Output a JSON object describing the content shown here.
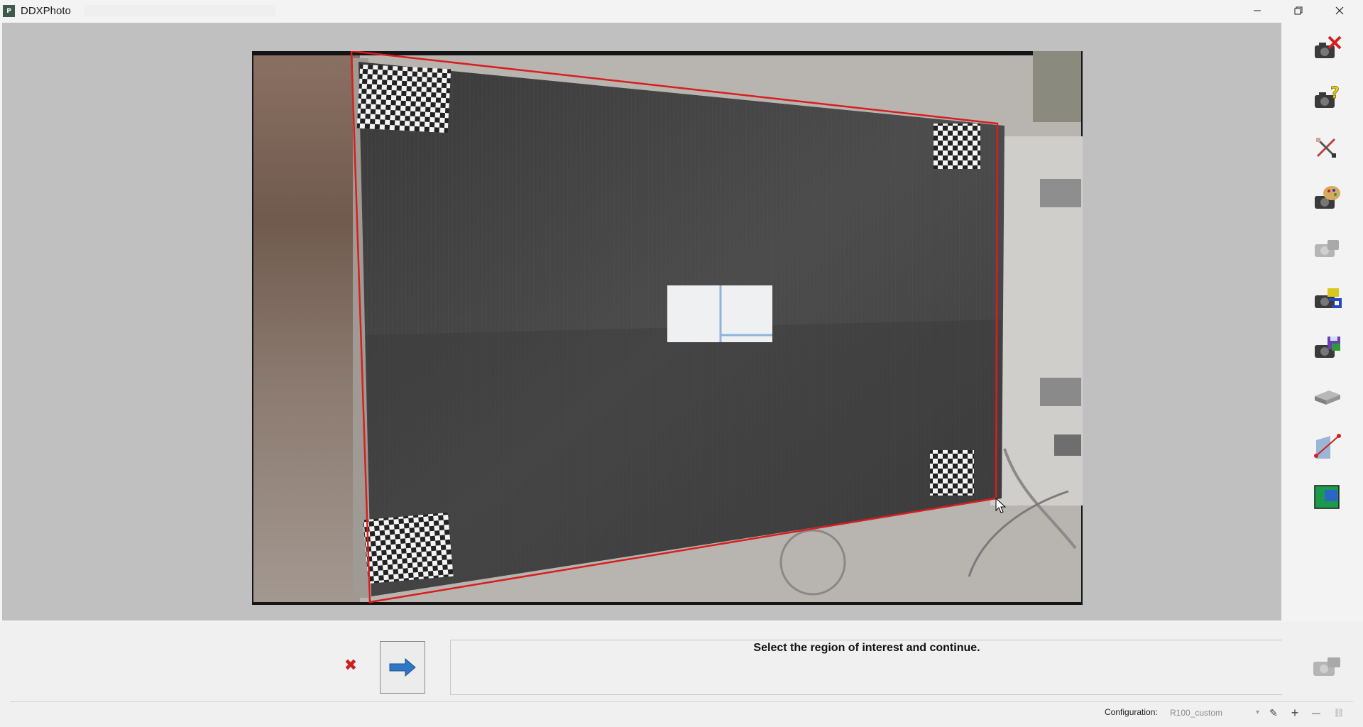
{
  "window": {
    "title": "DDXPhoto",
    "icon_text": "P"
  },
  "toolbar": {
    "tools": [
      {
        "name": "camera-remove-icon",
        "accent": "#d42020"
      },
      {
        "name": "camera-help-icon",
        "accent": "#e6d21e"
      },
      {
        "name": "measure-tools-icon",
        "accent": "#c04040"
      },
      {
        "name": "camera-palette-icon",
        "accent": "#d8a860"
      },
      {
        "name": "camera-disabled-icon",
        "accent": "#b0b0b0"
      },
      {
        "name": "camera-export-icon",
        "accent": "#2448c8"
      },
      {
        "name": "camera-save-icon",
        "accent": "#2f7a3a"
      },
      {
        "name": "slab-icon",
        "accent": "#909090"
      },
      {
        "name": "crack-line-icon",
        "accent": "#d42020"
      },
      {
        "name": "region-grid-icon",
        "accent": "#1a9a4a"
      }
    ]
  },
  "actions": {
    "cancel_icon": "✖",
    "next_icon": "arrow-right-icon"
  },
  "message": "Select the region of interest and continue.",
  "status": {
    "config_label": "Configuration:",
    "config_value": "R100_custom",
    "edit_icon": "✎",
    "add_icon": "+",
    "remove_icon": "—",
    "link_icon": "⛓"
  },
  "colors": {
    "roi_outline": "#d81e1e",
    "workspace_bg": "#c0c0c0",
    "arrow_blue": "#2f77c6"
  }
}
